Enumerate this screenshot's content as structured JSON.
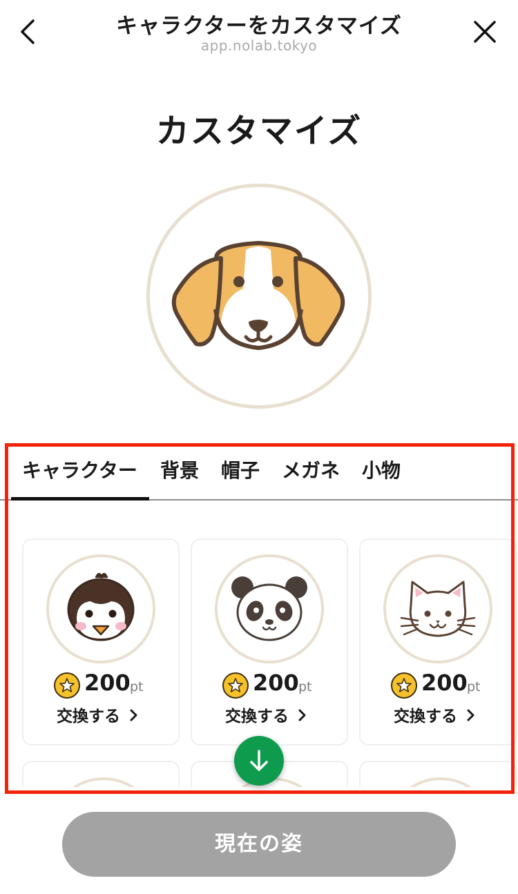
{
  "nav": {
    "title": "キャラクターをカスタマイズ",
    "url": "app.nolab.tokyo",
    "back_icon": "chevron-left-icon",
    "close_icon": "close-icon"
  },
  "page": {
    "title": "カスタマイズ",
    "current_avatar": "dog-face"
  },
  "tabs": [
    {
      "label": "キャラクター",
      "selected": true
    },
    {
      "label": "背景",
      "selected": false
    },
    {
      "label": "帽子",
      "selected": false
    },
    {
      "label": "メガネ",
      "selected": false
    },
    {
      "label": "小物",
      "selected": false
    }
  ],
  "items": [
    {
      "character": "penguin",
      "price": "200",
      "unit": "pt",
      "action": "交換する"
    },
    {
      "character": "panda",
      "price": "200",
      "unit": "pt",
      "action": "交換する"
    },
    {
      "character": "cat",
      "price": "200",
      "unit": "pt",
      "action": "交換する"
    }
  ],
  "scroll_button_icon": "arrow-down-icon",
  "cta": {
    "label": "現在の姿"
  },
  "colors": {
    "accent_green": "#0f9b4e",
    "coin_yellow": "#f6c12a",
    "ring_beige": "#e9dfcf",
    "highlight_red": "#f3230a",
    "cta_gray": "#a3a3a3"
  }
}
